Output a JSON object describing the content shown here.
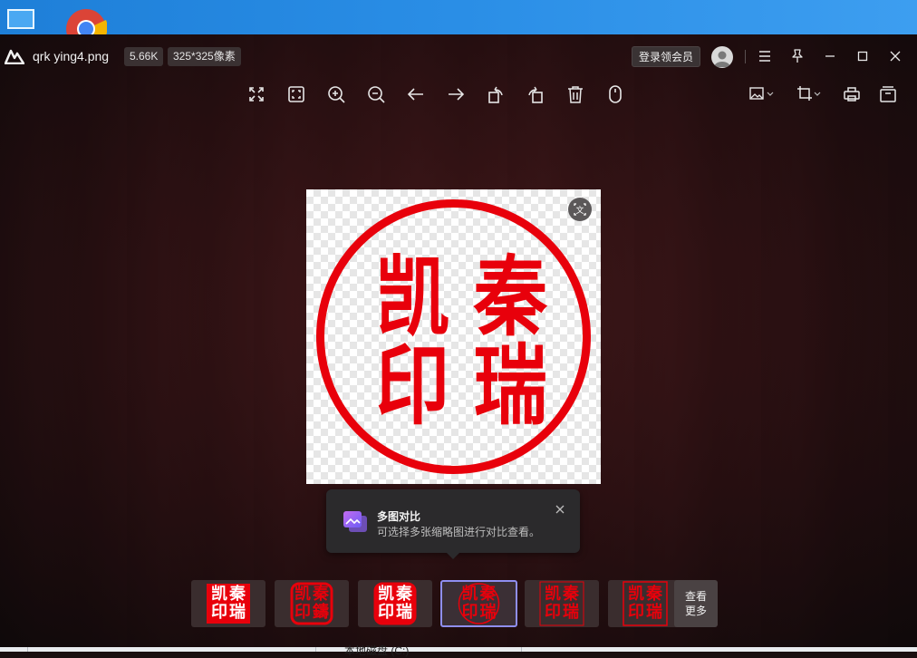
{
  "window": {
    "file_name": "qrk ying4.png",
    "file_size": "5.66K",
    "dimensions": "325*325像素",
    "login_label": "登录领会员"
  },
  "toolbar": {
    "left_tools": [
      "fullscreen-icon",
      "fit-window-icon",
      "zoom-in-icon",
      "zoom-out-icon",
      "previous-arrow-icon",
      "next-arrow-icon",
      "rotate-left-icon",
      "rotate-right-icon",
      "delete-icon",
      "mouse-icon"
    ],
    "right_tools": [
      "image-edit-icon",
      "crop-icon",
      "print-icon",
      "archive-icon"
    ]
  },
  "image": {
    "stamp_text": [
      "凯",
      "秦",
      "印",
      "瑞"
    ],
    "stamp_color": "#e8000b"
  },
  "tooltip": {
    "title": "多图对比",
    "description": "可选择多张缩略图进行对比查看。"
  },
  "thumbnails": {
    "items": [
      {
        "name": "thumb-square-filled",
        "text": [
          "凯",
          "秦",
          "印",
          "瑞"
        ],
        "active": false
      },
      {
        "name": "thumb-rounded-border",
        "text": [
          "凯",
          "秦",
          "印",
          "鑄"
        ],
        "active": false
      },
      {
        "name": "thumb-rounded-filled",
        "text": [
          "凯",
          "秦",
          "印",
          "瑞"
        ],
        "active": false
      },
      {
        "name": "thumb-circle",
        "text": [
          "凯",
          "秦",
          "印",
          "瑞"
        ],
        "active": true
      },
      {
        "name": "thumb-square-outline-thin",
        "text": [
          "凯",
          "秦",
          "印",
          "瑞"
        ],
        "active": false
      },
      {
        "name": "thumb-square-outline",
        "text": [
          "凯",
          "秦",
          "印",
          "瑞"
        ],
        "active": false
      }
    ],
    "more_line1": "查看",
    "more_line2": "更多"
  },
  "taskbar_fragment": {
    "text": "本地磁盘 (C:)"
  },
  "colors": {
    "accent": "#8f8ef0",
    "stamp_red": "#e8000b",
    "desktop_blue": "#2a8ee6"
  }
}
